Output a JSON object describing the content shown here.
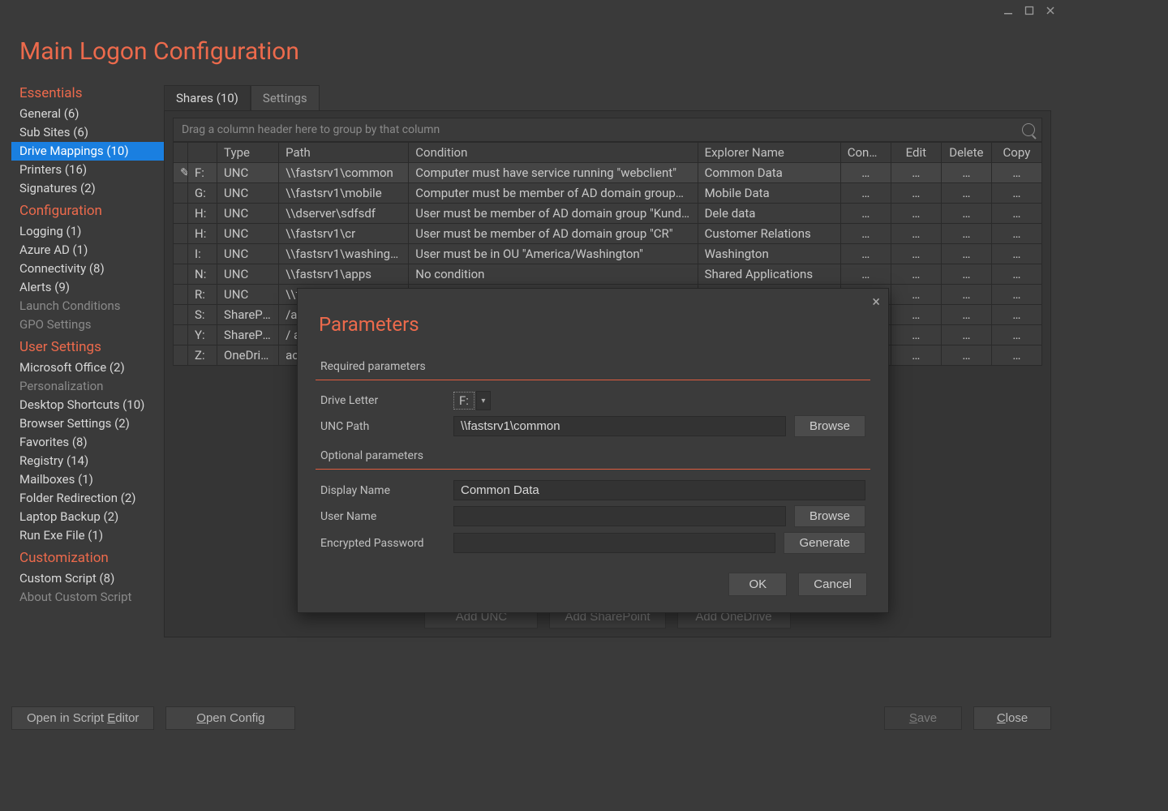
{
  "window": {
    "title": "Main Logon Configuration"
  },
  "sidebar": {
    "sections": [
      {
        "title": "Essentials",
        "items": [
          {
            "label": "General (6)"
          },
          {
            "label": "Sub Sites (6)"
          },
          {
            "label": "Drive Mappings (10)",
            "selected": true
          },
          {
            "label": "Printers (16)"
          },
          {
            "label": "Signatures (2)"
          }
        ]
      },
      {
        "title": "Configuration",
        "items": [
          {
            "label": "Logging (1)"
          },
          {
            "label": "Azure AD (1)"
          },
          {
            "label": "Connectivity (8)"
          },
          {
            "label": "Alerts (9)"
          },
          {
            "label": "Launch Conditions",
            "dim": true
          },
          {
            "label": "GPO Settings",
            "dim": true
          }
        ]
      },
      {
        "title": "User Settings",
        "items": [
          {
            "label": "Microsoft Office (2)"
          },
          {
            "label": "Personalization",
            "dim": true
          },
          {
            "label": "Desktop Shortcuts (10)"
          },
          {
            "label": "Browser Settings (2)"
          },
          {
            "label": "Favorites (8)"
          },
          {
            "label": "Registry (14)"
          },
          {
            "label": "Mailboxes (1)"
          },
          {
            "label": "Folder Redirection (2)"
          },
          {
            "label": "Laptop Backup (2)"
          },
          {
            "label": "Run Exe File (1)"
          }
        ]
      },
      {
        "title": "Customization",
        "items": [
          {
            "label": "Custom Script (8)"
          },
          {
            "label": "About Custom Script",
            "dim": true
          }
        ]
      }
    ]
  },
  "tabs": [
    {
      "label": "Shares (10)",
      "active": true
    },
    {
      "label": "Settings"
    }
  ],
  "grid": {
    "group_hint": "Drag a column header here to group by that column",
    "columns": [
      "",
      "",
      "Type",
      "Path",
      "Condition",
      "Explorer Name",
      "Condition",
      "Edit",
      "Delete",
      "Copy"
    ],
    "rows": [
      {
        "letter": "F:",
        "type": "UNC",
        "path": "\\\\fastsrv1\\common",
        "condition": "Computer must have service running \"webclient\"",
        "name": "Common Data",
        "selected": true,
        "handle": true
      },
      {
        "letter": "G:",
        "type": "UNC",
        "path": "\\\\fastsrv1\\mobile",
        "condition": "Computer must be member of AD domain group…",
        "name": "Mobile Data"
      },
      {
        "letter": "H:",
        "type": "UNC",
        "path": "\\\\dserver\\sdfsdf",
        "condition": "User must be member of AD domain group \"Kund…",
        "name": "Dele data"
      },
      {
        "letter": "H:",
        "type": "UNC",
        "path": "\\\\fastsrv1\\cr",
        "condition": "User must be member of AD domain group \"CR\"",
        "name": "Customer Relations"
      },
      {
        "letter": "I:",
        "type": "UNC",
        "path": "\\\\fastsrv1\\washington",
        "condition": "User must be in OU \"America/Washington\"",
        "name": "Washington"
      },
      {
        "letter": "N:",
        "type": "UNC",
        "path": "\\\\fastsrv1\\apps",
        "condition": "No condition",
        "name": "Shared Applications"
      },
      {
        "letter": "R:",
        "type": "UNC",
        "path": "\\\\fa",
        "condition": "",
        "name": ""
      },
      {
        "letter": "S:",
        "type": "SharePo…",
        "path": "/ac",
        "condition": "",
        "name": ""
      },
      {
        "letter": "Y:",
        "type": "SharePo…",
        "path": "/ a",
        "condition": "",
        "name": ""
      },
      {
        "letter": "Z:",
        "type": "OneDrive",
        "path": "ac",
        "condition": "",
        "name": ""
      }
    ],
    "action_label": "…"
  },
  "add_buttons": [
    {
      "label": "Add UNC"
    },
    {
      "label": "Add SharePoint"
    },
    {
      "label": "Add OneDrive"
    }
  ],
  "footer": {
    "open_script_editor": "Open in Script Editor",
    "open_config": "Open Config",
    "save": "Save",
    "close": "Close"
  },
  "modal": {
    "title": "Parameters",
    "required_header": "Required parameters",
    "optional_header": "Optional parameters",
    "drive_letter_label": "Drive Letter",
    "drive_letter_value": "F:",
    "unc_path_label": "UNC Path",
    "unc_path_value": "\\\\fastsrv1\\common",
    "display_name_label": "Display Name",
    "display_name_value": "Common Data",
    "user_name_label": "User Name",
    "user_name_value": "",
    "password_label": "Encrypted Password",
    "password_value": "",
    "browse": "Browse",
    "generate": "Generate",
    "ok": "OK",
    "cancel": "Cancel"
  }
}
